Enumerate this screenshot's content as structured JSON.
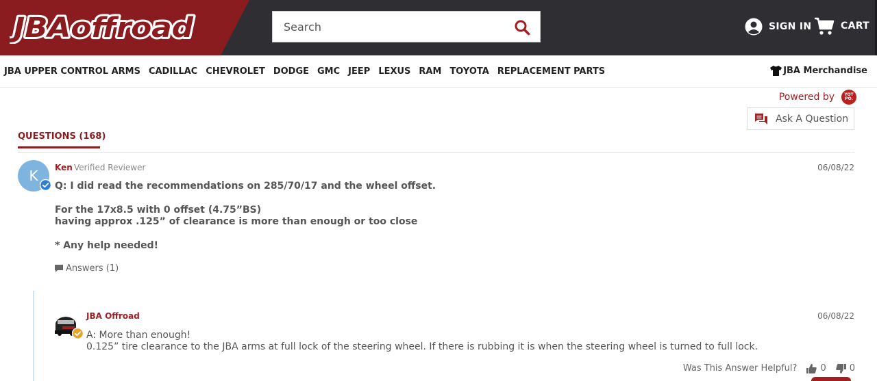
{
  "header": {
    "logo_text": "JBAoffroad",
    "search_placeholder": "Search",
    "sign_in_label": "SIGN IN",
    "cart_label": "CART"
  },
  "nav": {
    "items": [
      "JBA UPPER CONTROL ARMS",
      "CADILLAC",
      "CHEVROLET",
      "DODGE",
      "GMC",
      "JEEP",
      "LEXUS",
      "RAM",
      "TOYOTA",
      "REPLACEMENT PARTS"
    ],
    "merch_label": "JBA Merchandise"
  },
  "reviews": {
    "powered_by": "Powered by",
    "yotpo_logo_text": "YOT PO.",
    "ask_question_label": "Ask A Question",
    "tab_label": "QUESTIONS (168)"
  },
  "question": {
    "avatar_letter": "K",
    "author": "Ken",
    "role": "Verified Reviewer",
    "date": "06/08/22",
    "lines": [
      "Q: I did read the recommendations on 285/70/17 and the wheel offset.",
      "For the 17x8.5 with 0 offset (4.75”BS)",
      "having approx .125” of clearance is more than enough or too close",
      "* Any help needed!"
    ],
    "answers_label": "Answers (1)"
  },
  "answer": {
    "author": "JBA Offroad",
    "date": "06/08/22",
    "lines": [
      "A: More than enough!",
      "0.125” tire clearance to the JBA arms at full lock of the steering wheel. If there is rubbing it is when the steering wheel is turned to full lock."
    ],
    "helpful_label": "Was This Answer Helpful?",
    "up_count": "0",
    "down_count": "0"
  },
  "colors": {
    "brand_red": "#8a1c1f",
    "header_dark": "#2f2f33",
    "accent_blue": "#7fb4df"
  }
}
